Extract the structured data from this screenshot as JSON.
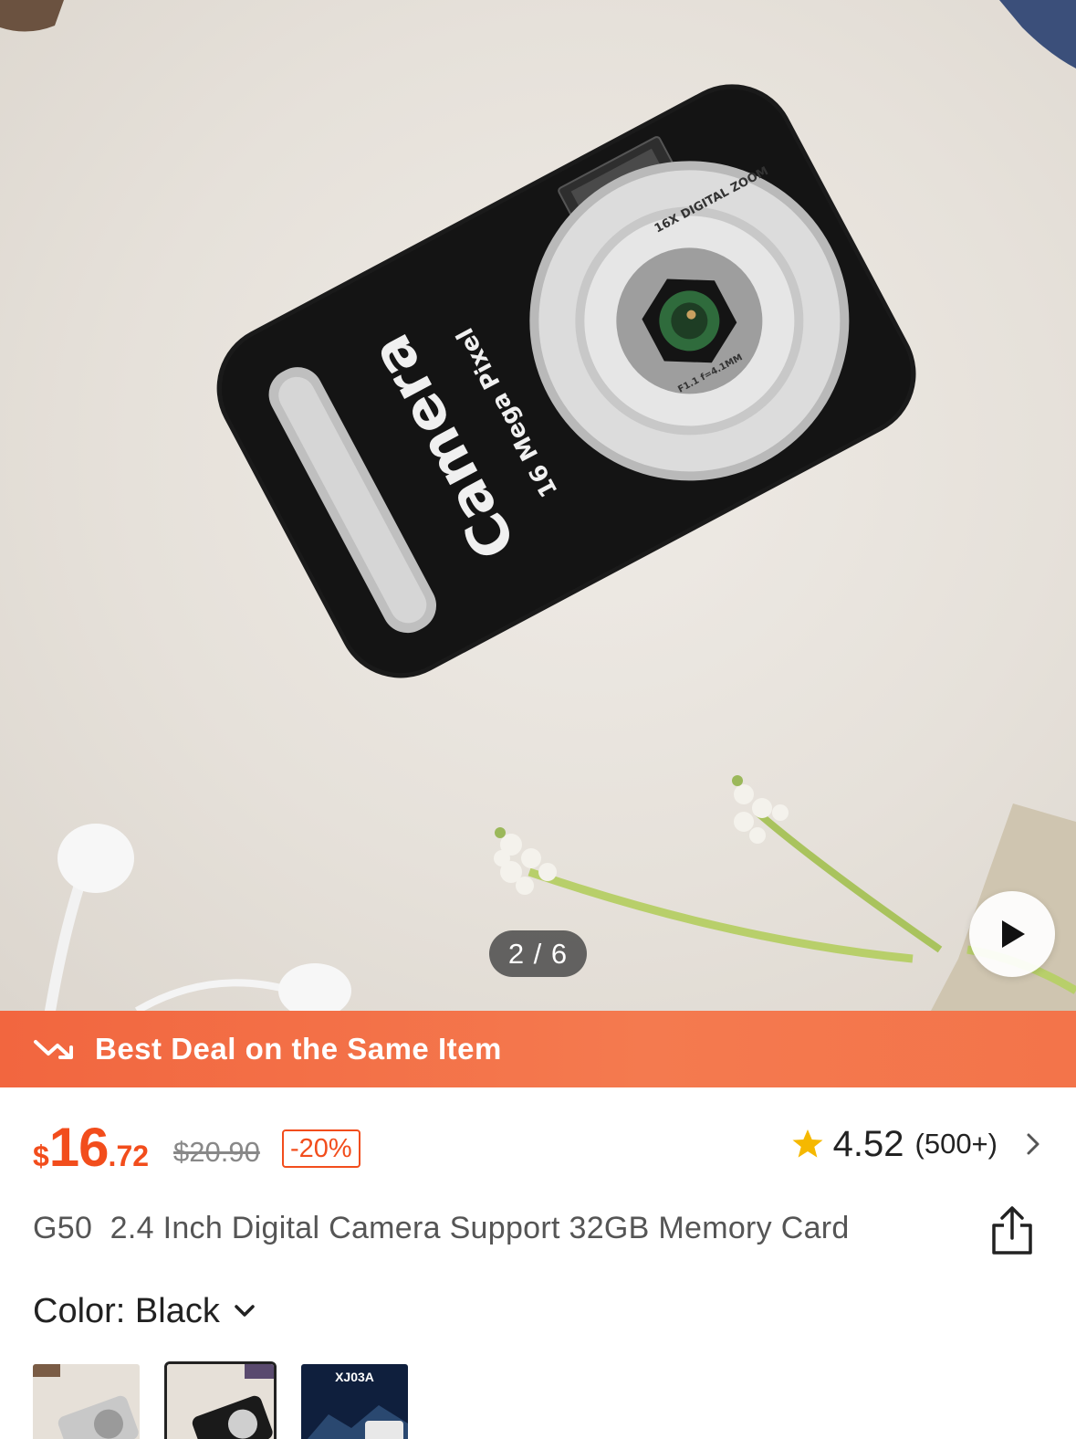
{
  "gallery": {
    "counter": "2 / 6",
    "camera_brand": "Camera",
    "camera_sub": "16 Mega Pixel",
    "lens_top": "16X DIGITAL ZOOM",
    "lens_bottom": "F1.1 f=4.1MM",
    "current_index": 2,
    "total": 6
  },
  "deal_banner": {
    "title": "Best Deal on the Same Item"
  },
  "price": {
    "currency": "$",
    "integer": "16",
    "decimal": ".72",
    "original": "$20.90",
    "discount": "-20%"
  },
  "rating": {
    "score": "4.52",
    "count": "(500+)"
  },
  "product": {
    "title": "G50  2.4 Inch Digital Camera Support 32GB Memory Card"
  },
  "color": {
    "label": "Color: Black",
    "swatches": [
      {
        "name": "Silver",
        "text": ""
      },
      {
        "name": "Black",
        "text": ""
      },
      {
        "name": "XJ03A",
        "text": "XJ03A"
      }
    ]
  },
  "colors": {
    "accent": "#f24d1c",
    "banner": "#f2663f"
  }
}
